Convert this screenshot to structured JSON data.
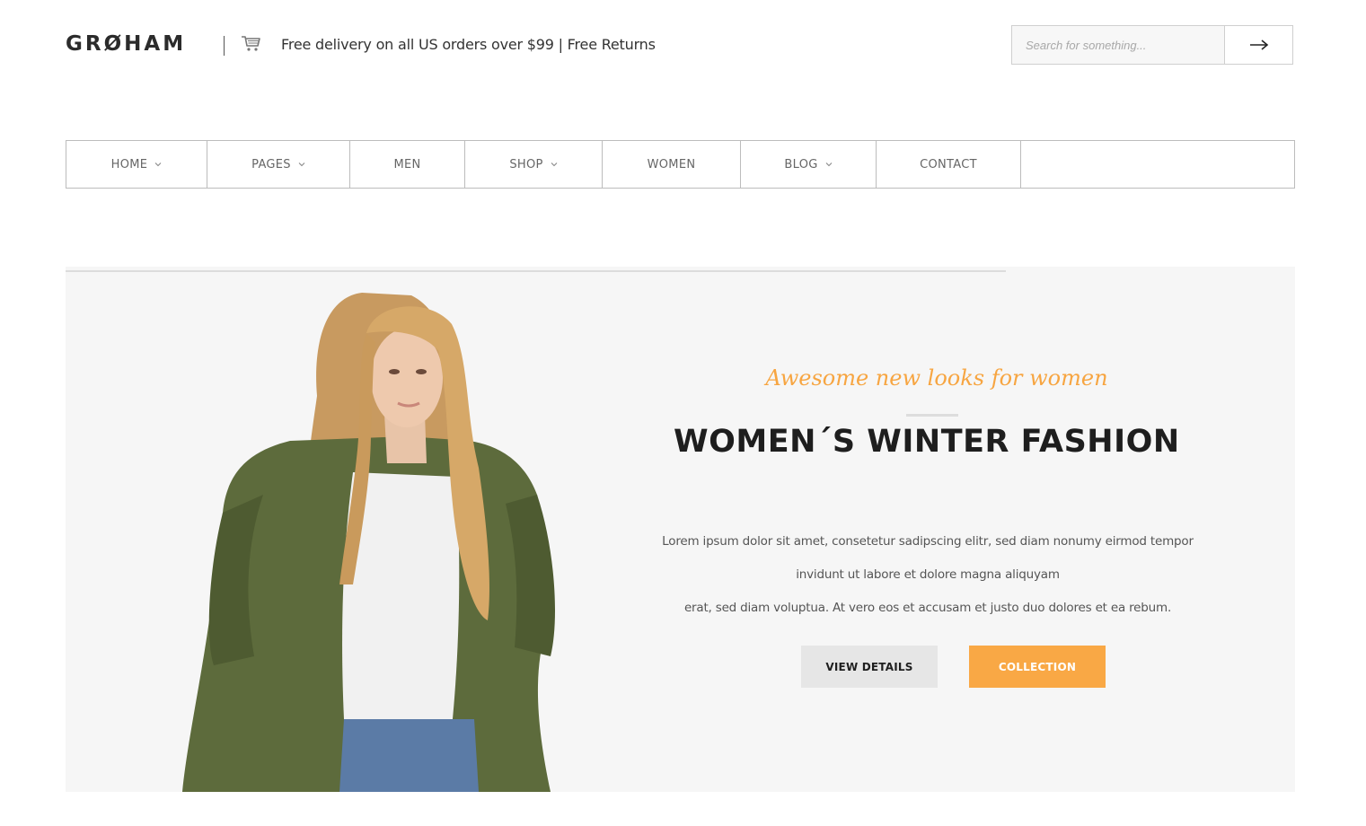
{
  "header": {
    "logo": "GRØHAM",
    "promo": "Free delivery on all US orders over $99 | Free Returns",
    "search_placeholder": "Search for something..."
  },
  "nav": {
    "items": [
      {
        "label": "HOME",
        "dropdown": true
      },
      {
        "label": "PAGES",
        "dropdown": true
      },
      {
        "label": "MEN",
        "dropdown": false
      },
      {
        "label": "SHOP",
        "dropdown": true
      },
      {
        "label": "WOMEN",
        "dropdown": false
      },
      {
        "label": "BLOG",
        "dropdown": true
      },
      {
        "label": "CONTACT",
        "dropdown": false
      }
    ]
  },
  "hero": {
    "tagline": "Awesome new looks for women",
    "title": "WOMEN´S WINTER FASHION",
    "body_lines": [
      "Lorem ipsum dolor sit amet, consetetur sadipscing elitr, sed diam nonumy eirmod tempor",
      "invidunt ut labore et dolore magna aliquyam",
      "erat, sed diam voluptua. At vero eos et accusam et justo duo dolores et ea rebum."
    ],
    "btn_details": "VIEW DETAILS",
    "btn_collection": "COLLECTION"
  },
  "colors": {
    "accent": "#f9a845",
    "text_dark": "#1e1e1e",
    "hero_bg": "#f6f6f6"
  },
  "icons": {
    "cart": "cart-icon",
    "search_submit": "arrow-right-icon",
    "dropdown": "chevron-down-icon"
  }
}
